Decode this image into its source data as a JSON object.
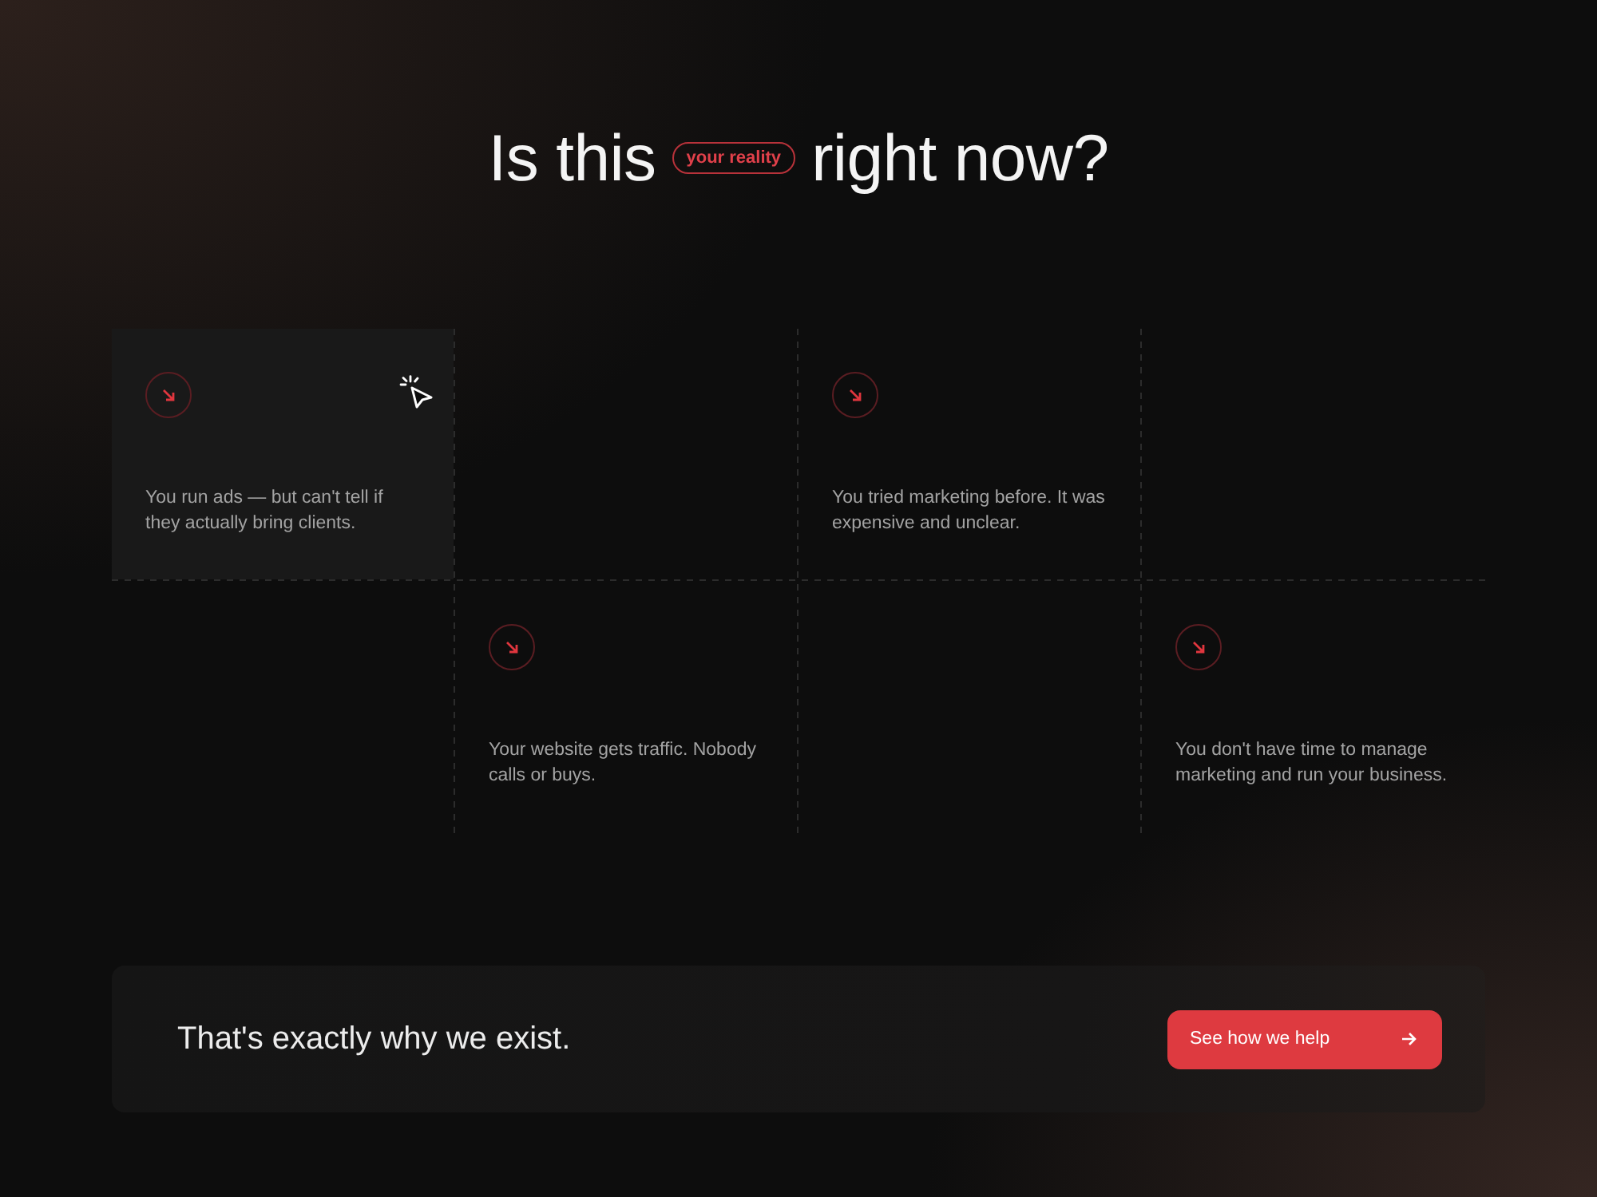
{
  "heading": {
    "before": "Is this",
    "tag": "your reality",
    "after": "right now?"
  },
  "grid": {
    "cells": [
      {
        "kind": "card",
        "text": "You run ads — but can't tell if they actually bring clients.",
        "hovered": true
      },
      {
        "kind": "empty"
      },
      {
        "kind": "card",
        "text": "You tried marketing before. It was expensive and unclear.",
        "hovered": false
      },
      {
        "kind": "empty"
      },
      {
        "kind": "empty"
      },
      {
        "kind": "card",
        "text": "Your website gets traffic. Nobody calls or buys.",
        "hovered": false
      },
      {
        "kind": "empty"
      },
      {
        "kind": "card",
        "text": "You don't have time to manage marketing and run your business.",
        "hovered": false
      }
    ]
  },
  "cta": {
    "text": "That's exactly why we exist.",
    "button": "See how we help"
  }
}
